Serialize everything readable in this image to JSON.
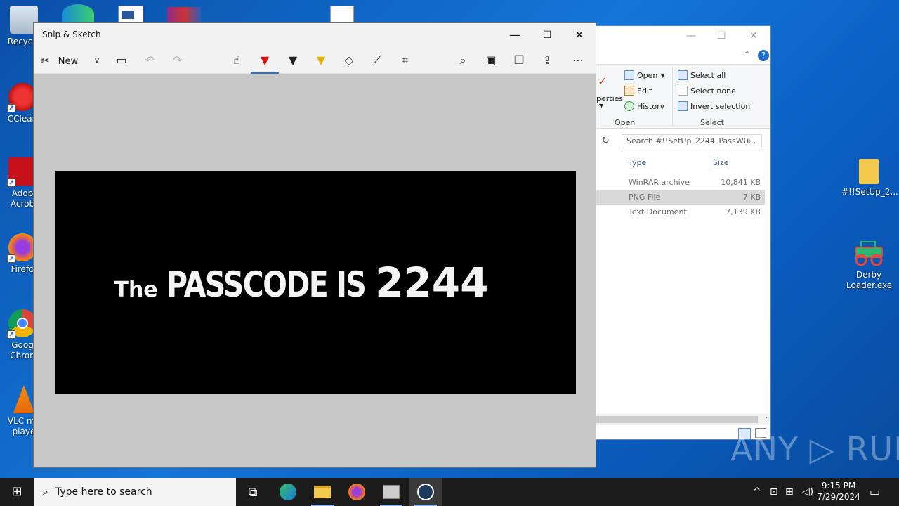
{
  "desktop": {
    "left_icons": [
      {
        "label": "Recycle",
        "icon": "recycle-bin-icon"
      },
      {
        "label": "CClean",
        "icon": "ccleaner-icon"
      },
      {
        "label": "Adob Acrob",
        "icon": "acrobat-icon"
      },
      {
        "label": "Firefo",
        "icon": "firefox-icon"
      },
      {
        "label": "Goog Chron",
        "icon": "chrome-icon"
      },
      {
        "label": "VLC me playe",
        "icon": "vlc-icon"
      }
    ],
    "right_icons": [
      {
        "label": "#!!SetUp_2...",
        "icon": "folder-icon"
      },
      {
        "label": "Derby Loader.exe",
        "icon": "jeep-icon"
      }
    ]
  },
  "snip": {
    "title": "Snip & Sketch",
    "new_label": "New",
    "image_text": {
      "w1": "The",
      "w2": "PASSCODE IS",
      "w3": "2244"
    }
  },
  "explorer": {
    "ribbon": {
      "open_label": "Open",
      "edit_label": "Edit",
      "history_label": "History",
      "select_all": "Select all",
      "select_none": "Select none",
      "invert_selection": "Invert selection",
      "properties_partial": "perties",
      "group_open": "Open",
      "group_select": "Select"
    },
    "search_placeholder": "Search #!!SetUp_2244_PassW0...",
    "columns": {
      "type": "Type",
      "size": "Size"
    },
    "rows": [
      {
        "type": "WinRAR archive",
        "size": "10,841 KB"
      },
      {
        "type": "PNG File",
        "size": "7 KB"
      },
      {
        "type": "Text Document",
        "size": "7,139 KB"
      }
    ]
  },
  "watermark": "ANY ▷ RUN",
  "taskbar": {
    "search_placeholder": "Type here to search",
    "time": "9:15 PM",
    "date": "7/29/2024"
  }
}
